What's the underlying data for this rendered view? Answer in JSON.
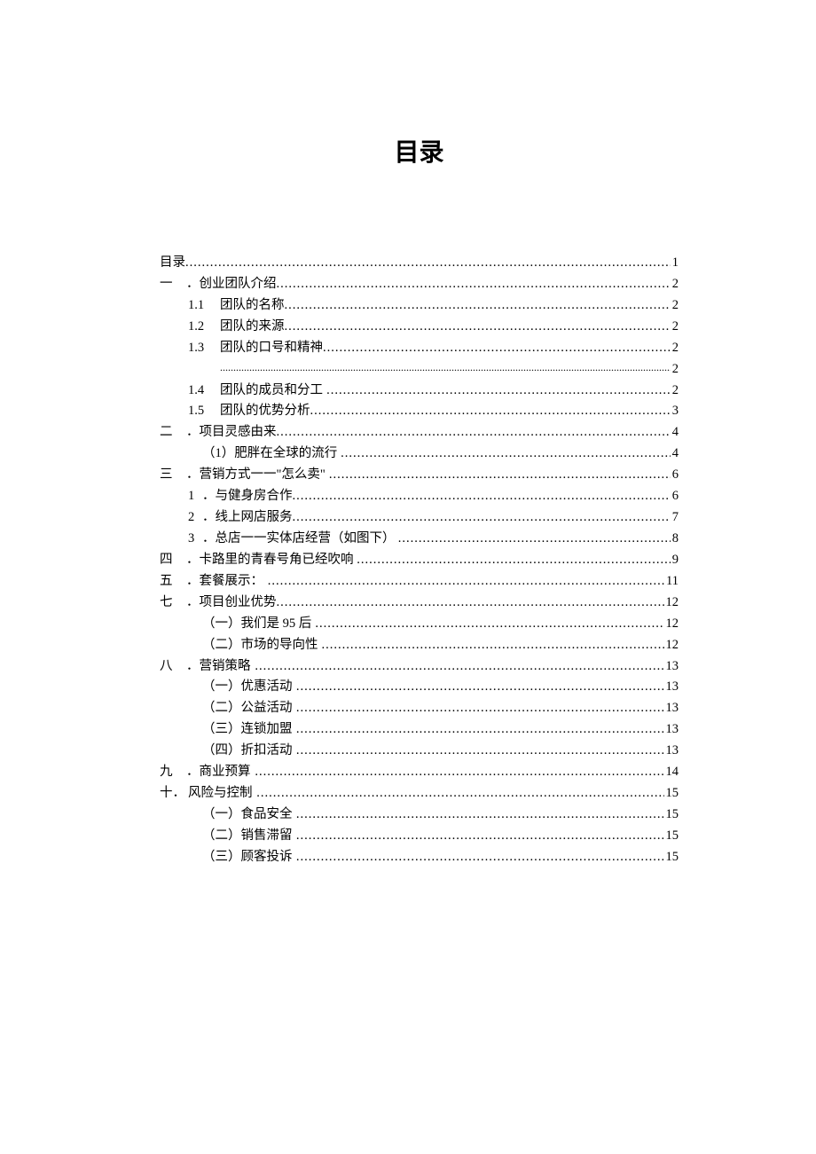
{
  "title": "目录",
  "toc": {
    "r0": {
      "num": "",
      "label": "目录",
      "page": "1"
    },
    "r1": {
      "num": "一",
      "label": "．创业团队介绍",
      "page": "2"
    },
    "r2": {
      "num": "1.1",
      "label": "团队的名称",
      "page": "2"
    },
    "r3": {
      "num": "1.2",
      "label": "团队的来源",
      "page": "2"
    },
    "r4": {
      "num": "1.3",
      "label": "团队的口号和精神",
      "page": "2"
    },
    "r4b": {
      "page": "2"
    },
    "r5": {
      "num": "1.4",
      "label": "团队的成员和分工",
      "page": "2"
    },
    "r6": {
      "num": "1.5",
      "label": "团队的优势分析",
      "page": "3"
    },
    "r7": {
      "num": "二",
      "label": "．项目灵感由来",
      "page": "4"
    },
    "r8": {
      "num": "",
      "label": "（1）肥胖在全球的流行",
      "page": "4"
    },
    "r9": {
      "num": "三",
      "label": "．营销方式一一\"怎么卖\"",
      "page": "6"
    },
    "r10": {
      "num": "1",
      "label": "．与健身房合作",
      "page": "6"
    },
    "r11": {
      "num": "2",
      "label": "．线上网店服务",
      "page": "7"
    },
    "r12": {
      "num": "3",
      "label": "．总店一一实体店经营（如图下）",
      "page": "8"
    },
    "r13": {
      "num": "四",
      "label": "．卡路里的青春号角已经吹响",
      "page": "9"
    },
    "r14": {
      "num": "五",
      "label": "．套餐展示：",
      "page": "11"
    },
    "r15": {
      "num": "七",
      "label": "．项目创业优势",
      "page": "12"
    },
    "r16": {
      "num": "",
      "label": "（一）我们是 95 后",
      "page": "12"
    },
    "r17": {
      "num": "",
      "label": "（二）市场的导向性",
      "page": "12"
    },
    "r18": {
      "num": "八",
      "label": "．营销策略",
      "page": "13"
    },
    "r19": {
      "num": "",
      "label": "（一）优惠活动",
      "page": "13"
    },
    "r20": {
      "num": "",
      "label": "（二）公益活动",
      "page": "13"
    },
    "r21": {
      "num": "",
      "label": "（三）连锁加盟",
      "page": "13"
    },
    "r22": {
      "num": "",
      "label": "（四）折扣活动",
      "page": "13"
    },
    "r23": {
      "num": "九",
      "label": "．商业预算",
      "page": "14"
    },
    "r24": {
      "num": "十．",
      "label": "风险与控制",
      "page": "15"
    },
    "r25": {
      "num": "",
      "label": "（一）食品安全",
      "page": "15"
    },
    "r26": {
      "num": "",
      "label": "（二）销售滞留",
      "page": "15"
    },
    "r27": {
      "num": "",
      "label": "（三）顾客投诉",
      "page": "15"
    }
  }
}
